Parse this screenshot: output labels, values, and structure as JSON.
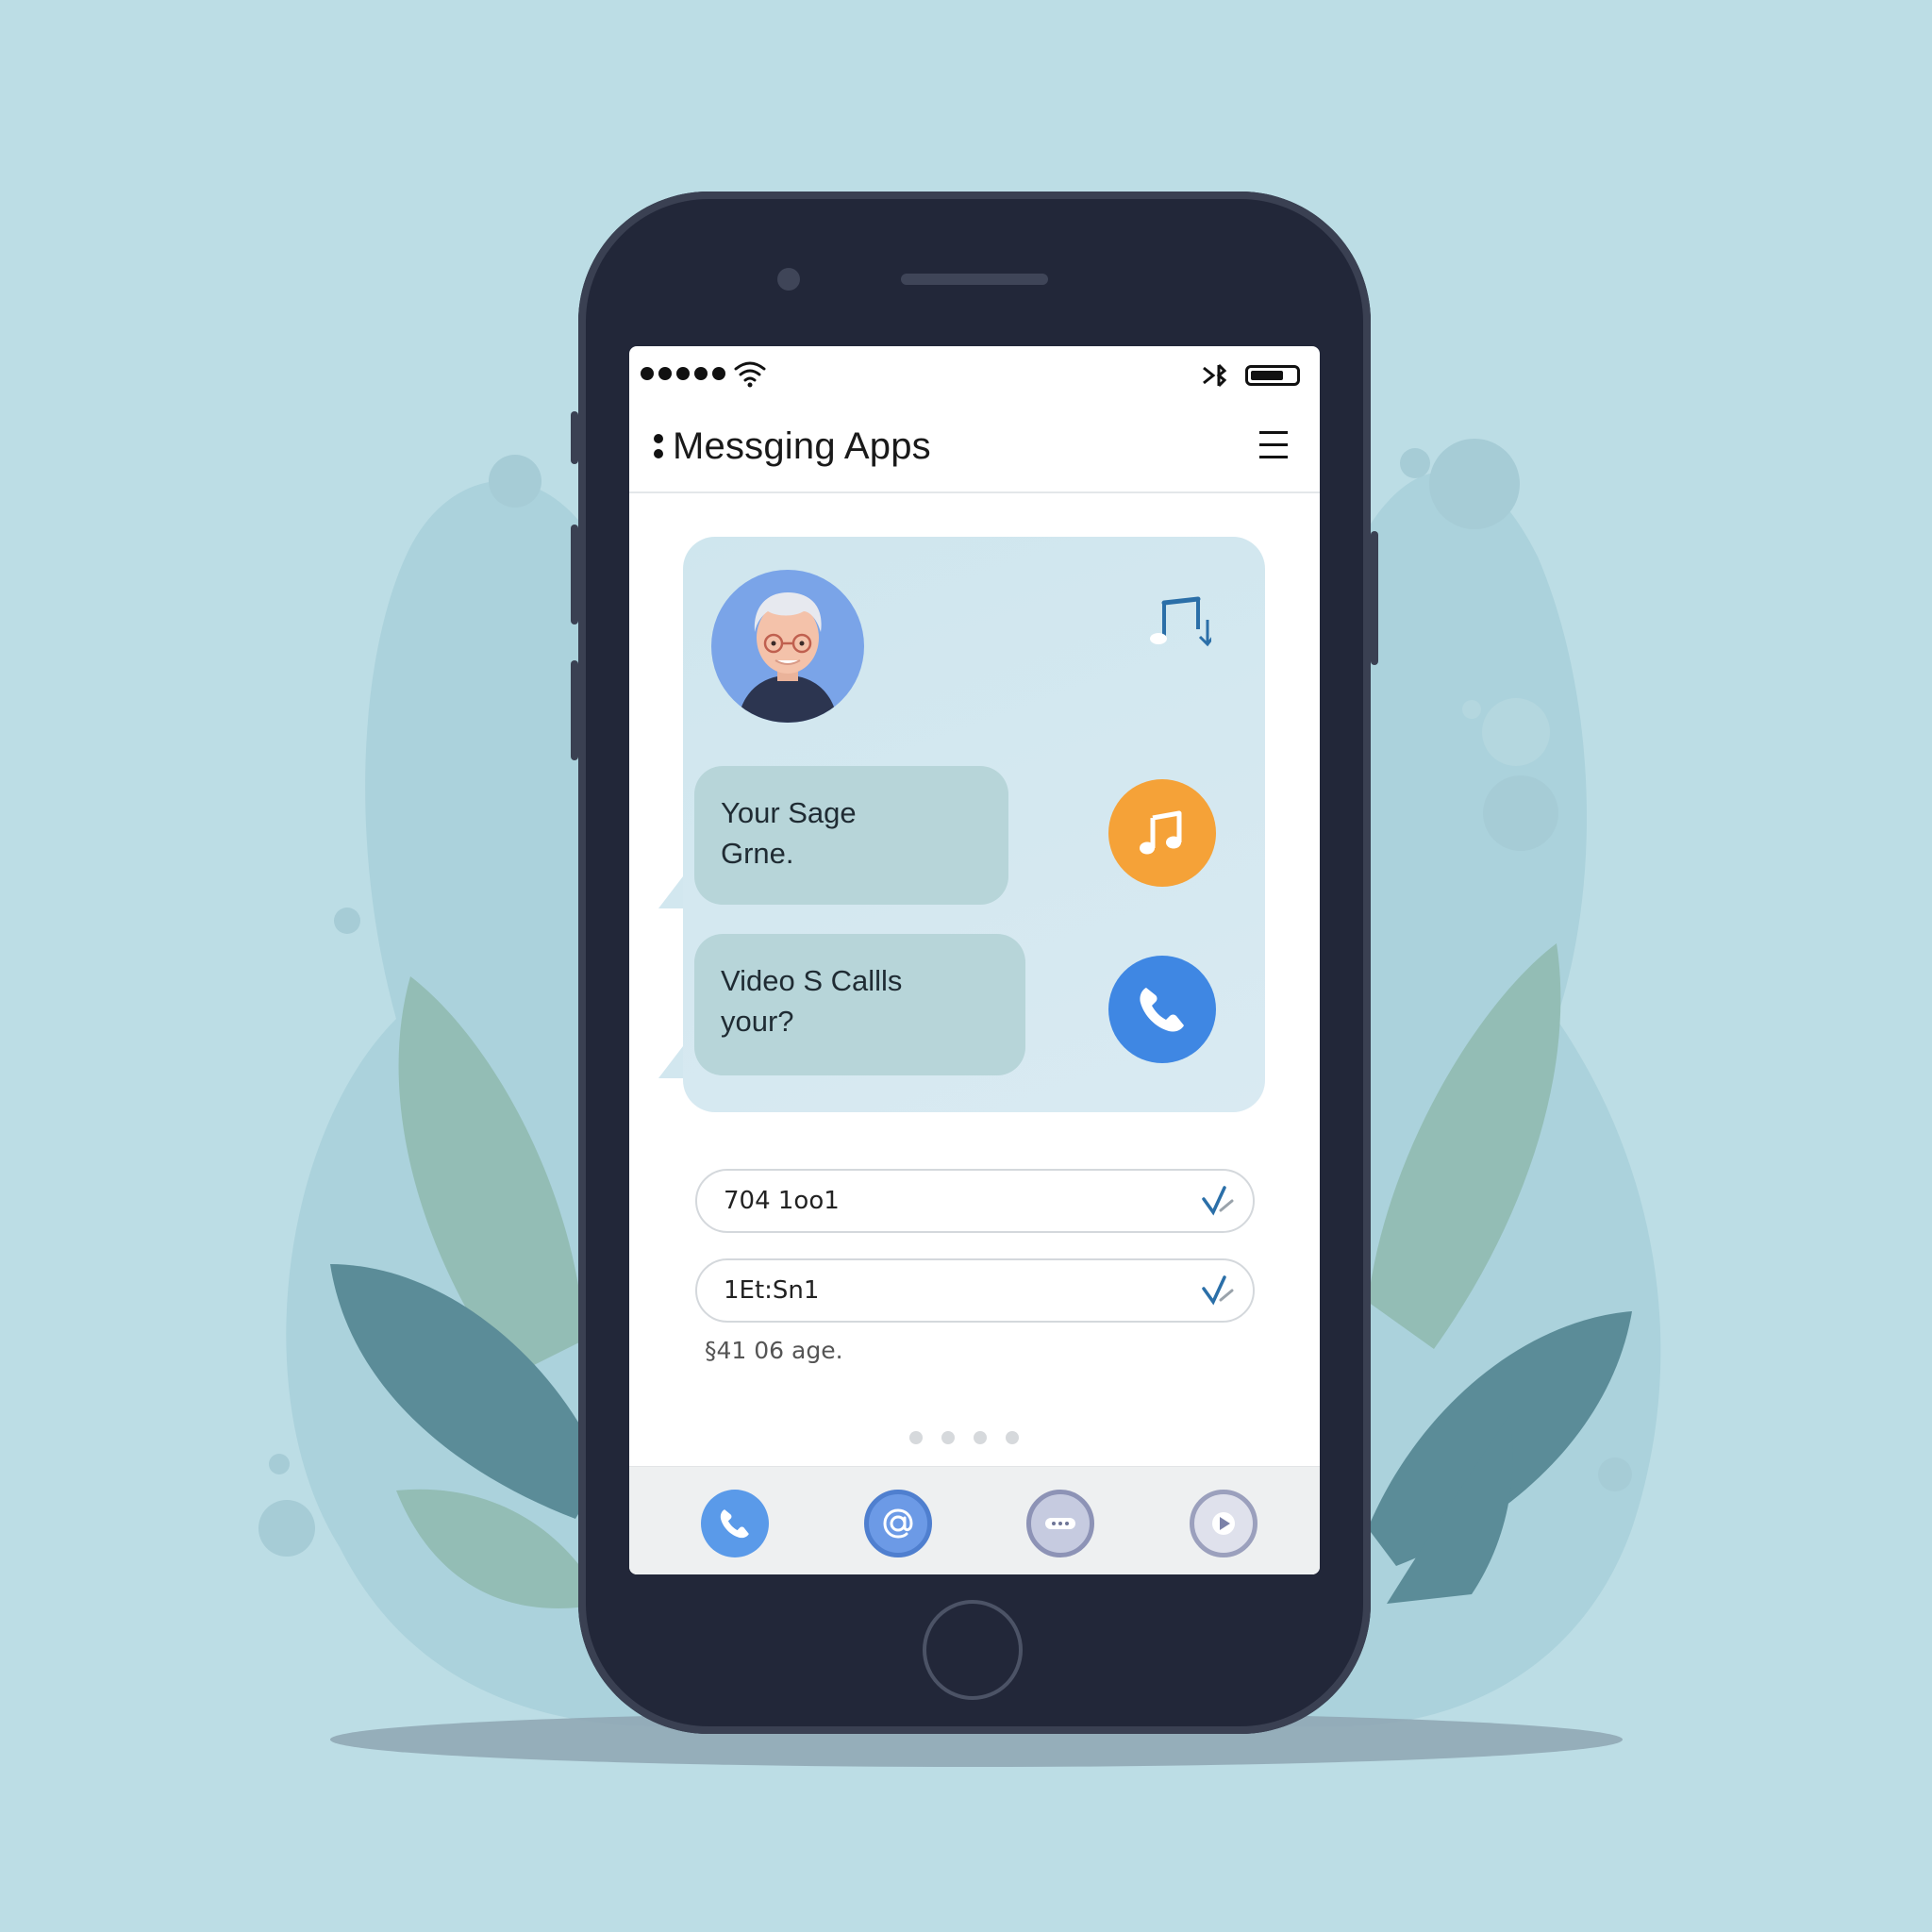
{
  "header": {
    "title": "Messging Apps"
  },
  "card": {
    "bubbles": [
      {
        "line1": "Your Sage",
        "line2": "Grne."
      },
      {
        "line1": "Video S Callls",
        "line2": "your?"
      }
    ]
  },
  "fields": [
    {
      "value": "704 1oo1"
    },
    {
      "value": "1Et:Sn1"
    }
  ],
  "caption": "§41 06 age.",
  "colors": {
    "background": "#bcdde5",
    "phone_body": "#222739",
    "music_button": "#f5a238",
    "call_button": "#3f87e3",
    "bubble": "#b7d5d9"
  },
  "icons": [
    "wifi-icon",
    "bluetooth-icon",
    "battery-icon",
    "menu-icon",
    "music-note-icon",
    "phone-icon",
    "at-icon",
    "chat-icon",
    "play-icon",
    "check-icon"
  ]
}
